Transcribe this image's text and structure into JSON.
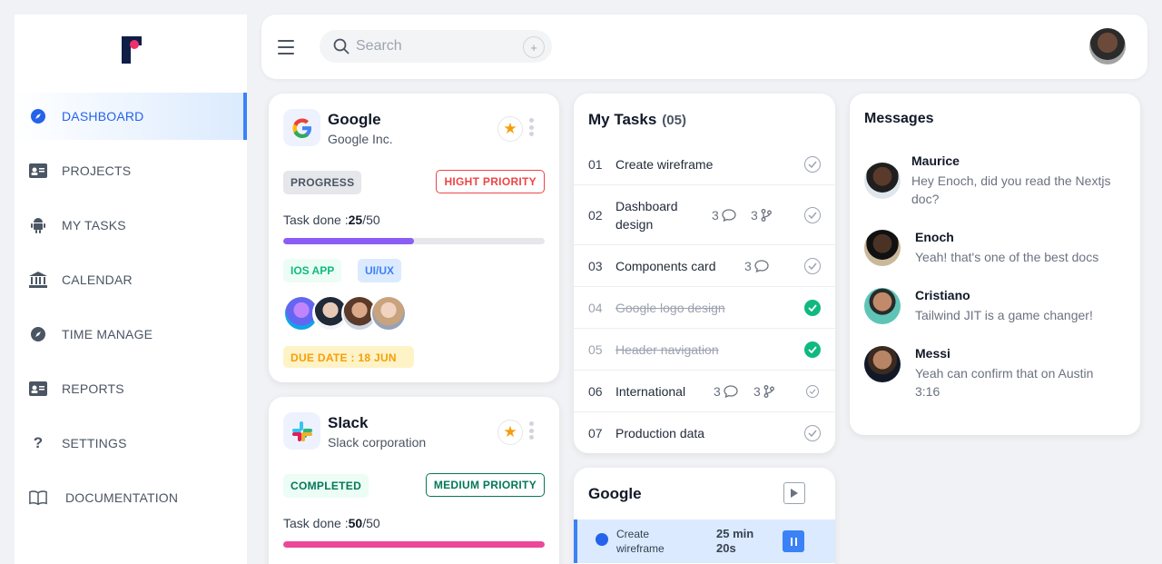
{
  "sidebar": {
    "items": [
      {
        "label": "DASHBOARD",
        "icon": "compass-icon",
        "active": true
      },
      {
        "label": "PROJECTS",
        "icon": "id-card-icon"
      },
      {
        "label": "MY TASKS",
        "icon": "android-icon"
      },
      {
        "label": "CALENDAR",
        "icon": "bank-icon"
      },
      {
        "label": "TIME MANAGE",
        "icon": "compass-icon"
      },
      {
        "label": "REPORTS",
        "icon": "id-card-icon"
      },
      {
        "label": "SETTINGS",
        "icon": "question-icon"
      },
      {
        "label": "DOCUMENTATION",
        "icon": "book-icon"
      }
    ]
  },
  "topbar": {
    "search_placeholder": "Search",
    "plus": "+"
  },
  "projects": [
    {
      "company": "Google",
      "subtitle": "Google Inc.",
      "status": "PROGRESS",
      "priority": "HIGHT PRIORITY",
      "task_label": "Task done :",
      "done": "25",
      "total": "/50",
      "progress": 0.5,
      "tags": [
        "IOS APP",
        "UI/UX"
      ],
      "due": "DUE DATE : 18 JUN"
    },
    {
      "company": "Slack",
      "subtitle": "Slack corporation",
      "status": "COMPLETED",
      "priority": "MEDIUM PRIORITY",
      "task_label": "Task done :",
      "done": "50",
      "total": "/50",
      "progress": 1.0
    }
  ],
  "tasks": {
    "title": "My Tasks",
    "count": "(05)",
    "items": [
      {
        "num": "01",
        "name": "Create wireframe"
      },
      {
        "num": "02",
        "name": "Dashboard design",
        "comments": "3",
        "branches": "3"
      },
      {
        "num": "03",
        "name": "Components card",
        "comments": "3"
      },
      {
        "num": "04",
        "name": "Google logo design",
        "done": true
      },
      {
        "num": "05",
        "name": "Header navigation",
        "done": true
      },
      {
        "num": "06",
        "name": "International",
        "comments": "3",
        "branches": "3"
      },
      {
        "num": "07",
        "name": "Production data"
      }
    ]
  },
  "timer": {
    "title": "Google",
    "task": "Create wireframe",
    "time": "25 min 20s"
  },
  "messages": {
    "title": "Messages",
    "items": [
      {
        "name": "Maurice",
        "text": "Hey Enoch, did you read the Nextjs doc?"
      },
      {
        "name": "Enoch",
        "text": "Yeah! that's one of the best docs"
      },
      {
        "name": "Cristiano",
        "text": "Tailwind JIT is a game changer!"
      },
      {
        "name": "Messi",
        "text": "Yeah can confirm that on Austin 3:16"
      }
    ]
  },
  "colors": {
    "accent": "#3b82f6",
    "high_priority": "#ef4444",
    "medium_priority": "#047857",
    "progress_purple": "#8b5cf6",
    "progress_pink": "#ec4899",
    "done_green": "#10b981"
  }
}
